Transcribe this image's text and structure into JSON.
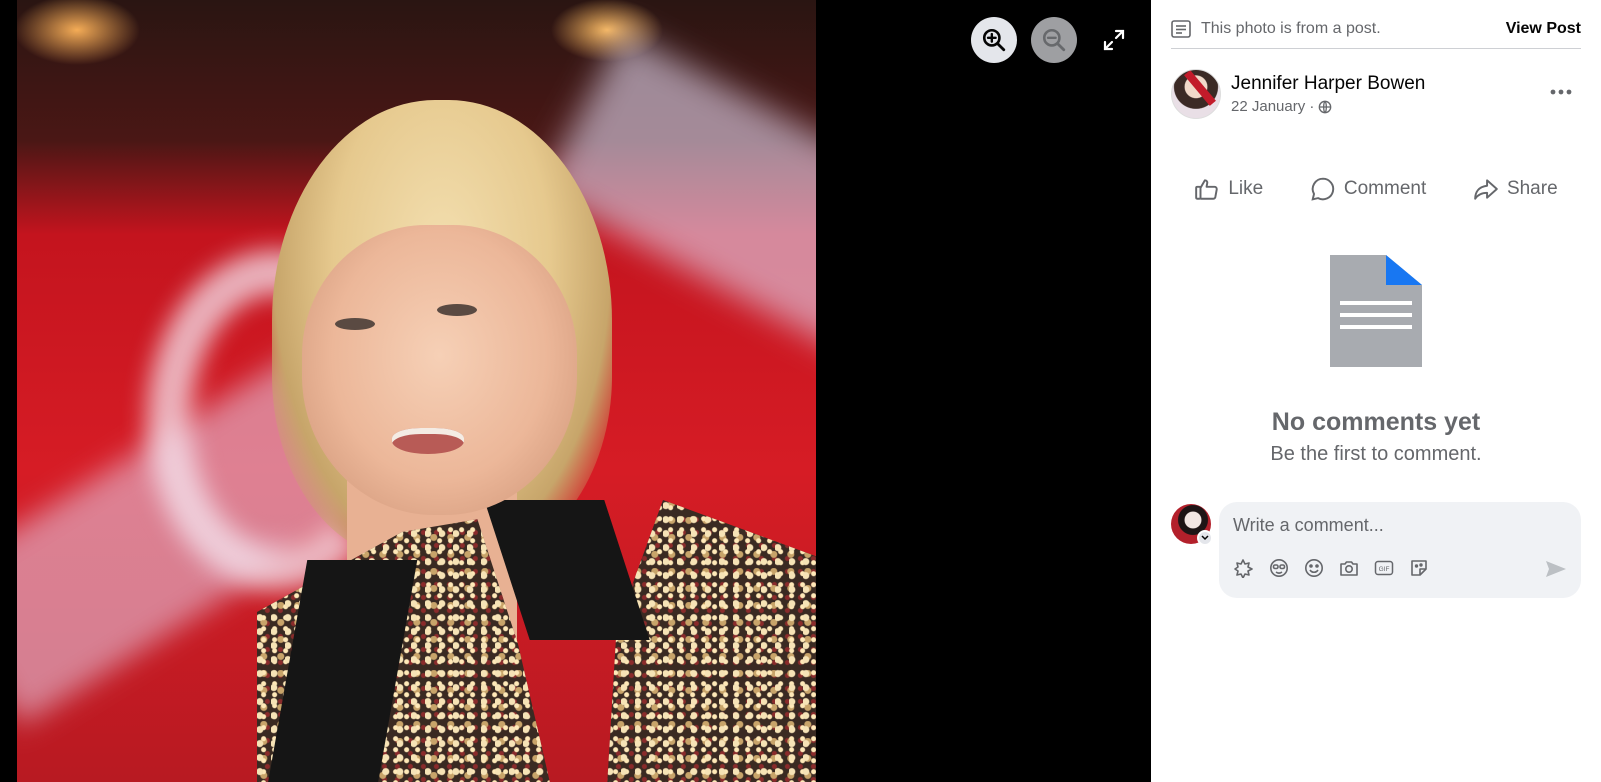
{
  "viewer": {
    "photo_alt": "",
    "controls": [
      "zoom-in-icon",
      "zoom-out-icon",
      "fullscreen-icon"
    ]
  },
  "post": {
    "notice": "This photo is from a post.",
    "view_post": "View Post",
    "author": "Jennifer Harper Bowen",
    "date": "22 January ·",
    "privacy_icon": "globe-icon"
  },
  "actions": {
    "like": "Like",
    "comment": "Comment",
    "share": "Share"
  },
  "comments": {
    "empty_title": "No comments yet",
    "empty_subtitle": "Be the first to comment."
  },
  "composer": {
    "placeholder": "Write a comment...",
    "tools": [
      "avatar-sticker-icon",
      "emoji-face-icon",
      "smiley-icon",
      "camera-icon",
      "gif-icon",
      "sticker-icon"
    ],
    "send_icon": "send-icon"
  },
  "colors": {
    "accent": "#1877f2",
    "secondary_text": "#65676b",
    "primary_text": "#050505",
    "viewer_bg": "#000000",
    "input_bg": "#f0f2f5"
  }
}
